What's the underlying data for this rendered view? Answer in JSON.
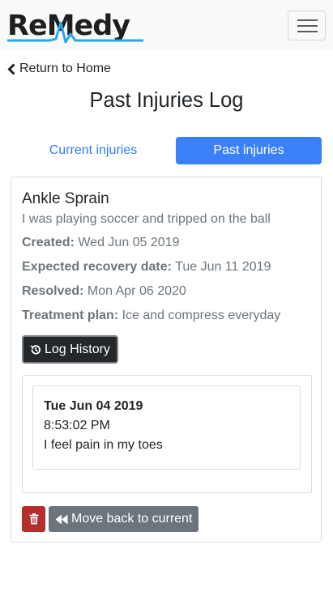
{
  "brand": {
    "logo_text": "ReMedy",
    "logo_color": "#1f1f1f",
    "logo_accent": "#29a6ea"
  },
  "nav": {
    "menu_icon": "hamburger-icon",
    "return_label": "Return to Home",
    "return_icon": "chevron-left-icon"
  },
  "page": {
    "title": "Past Injuries Log"
  },
  "tabs": [
    {
      "label": "Current injuries",
      "active": false
    },
    {
      "label": "Past injuries",
      "active": true
    }
  ],
  "injury": {
    "title": "Ankle Sprain",
    "description": "I was playing soccer and tripped on the ball",
    "fields": [
      {
        "label": "Created:",
        "value": "Wed Jun 05 2019"
      },
      {
        "label": "Expected recovery date:",
        "value": "Tue Jun 11 2019"
      },
      {
        "label": "Resolved:",
        "value": "Mon Apr 06 2020"
      },
      {
        "label": "Treatment plan:",
        "value": "Ice and compress everyday"
      }
    ],
    "log_history_label": "Log History",
    "history": [
      {
        "date": "Tue Jun 04 2019",
        "time": "8:53:02 PM",
        "note": "I feel pain in my toes"
      }
    ],
    "move_back_label": "Move back to current"
  },
  "colors": {
    "primary": "#3a80f8",
    "danger": "#b52e2e",
    "secondary": "#6c757d",
    "dark": "#25282b"
  }
}
